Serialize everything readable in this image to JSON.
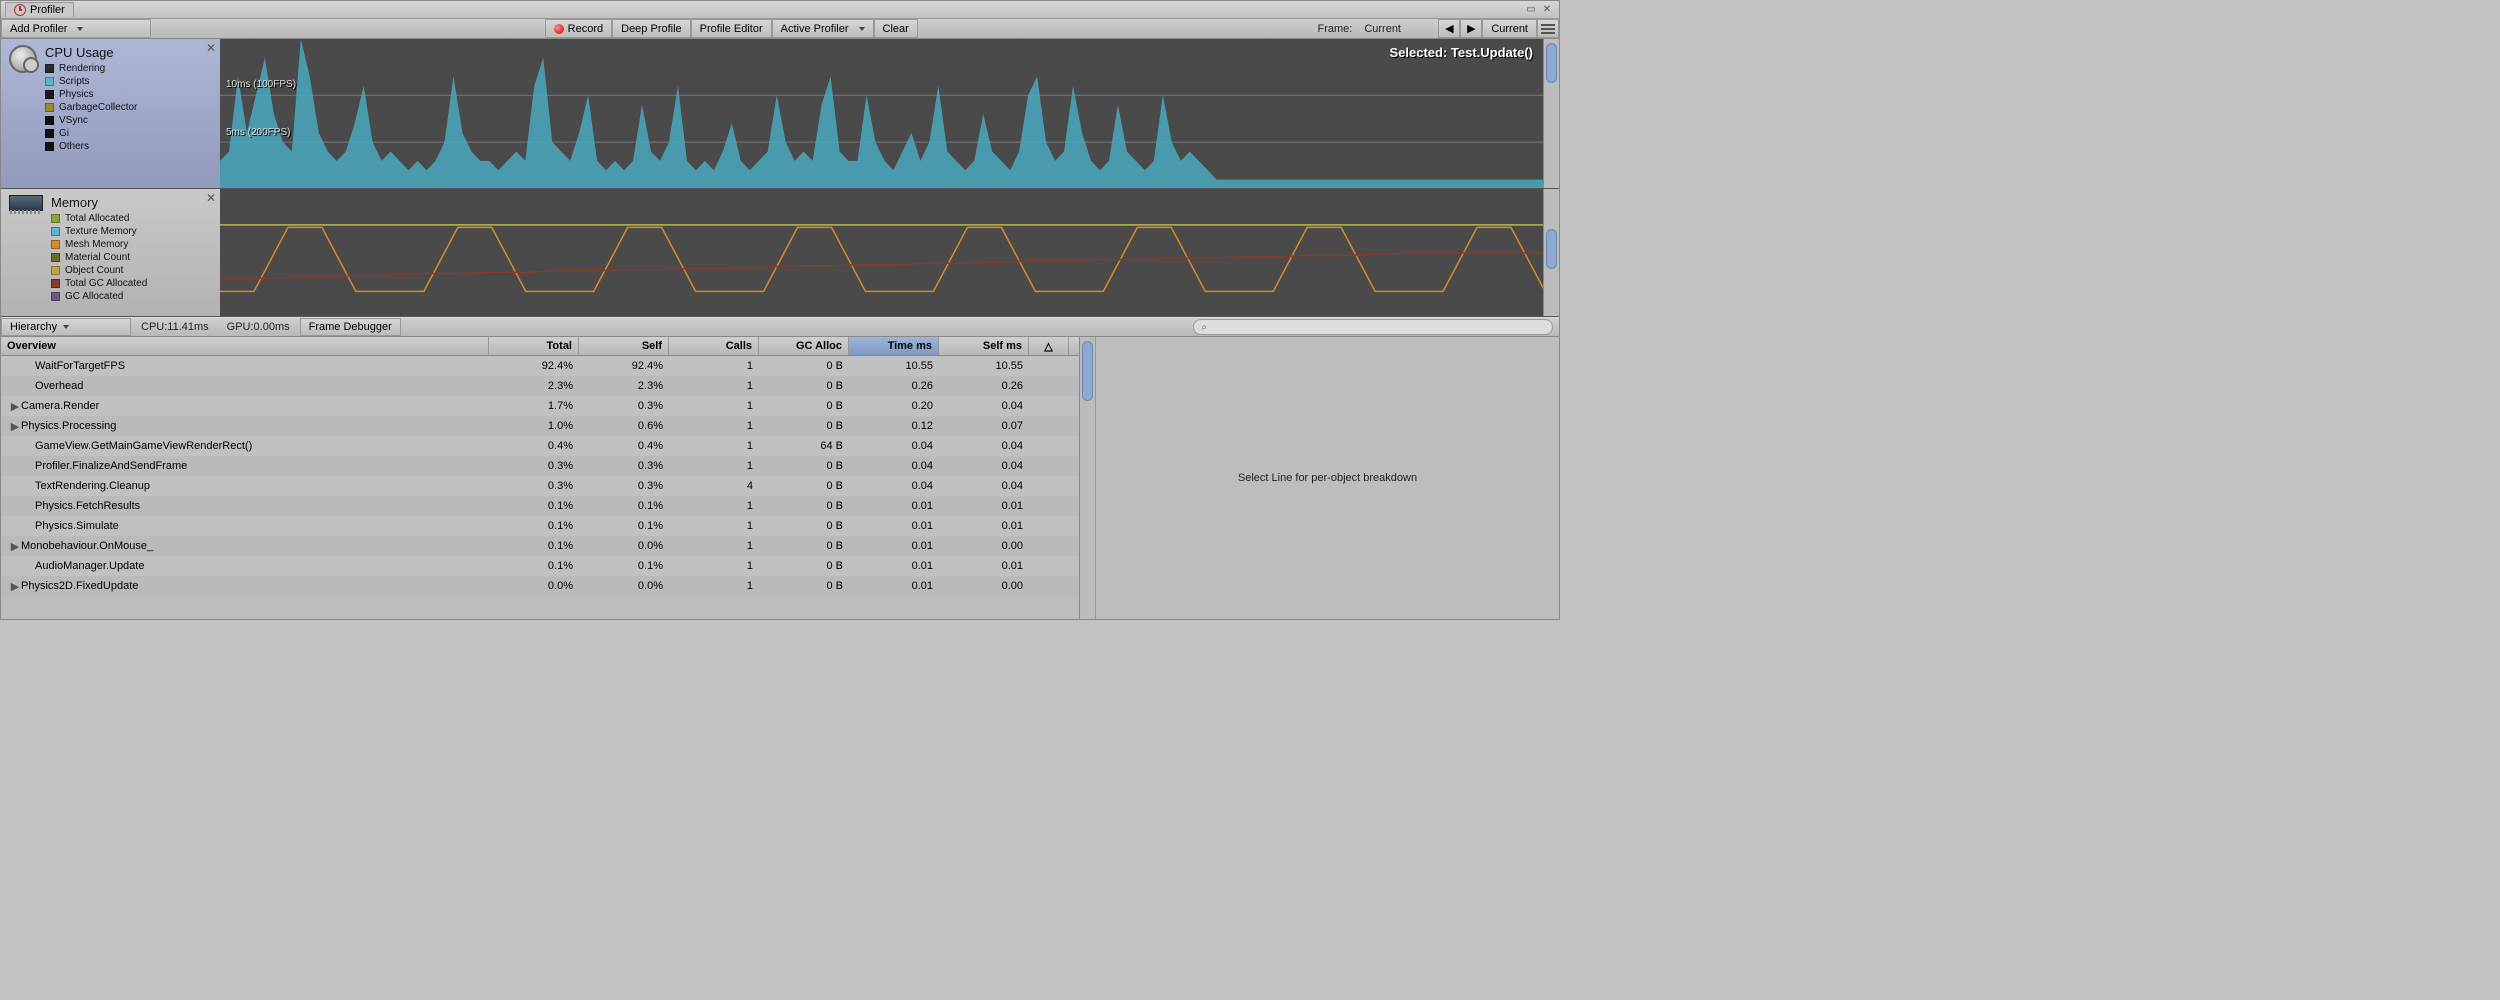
{
  "window": {
    "title": "Profiler"
  },
  "toolbar": {
    "add_profiler": "Add Profiler",
    "record": "Record",
    "deep_profile": "Deep Profile",
    "profile_editor": "Profile Editor",
    "active_profiler": "Active Profiler",
    "clear": "Clear",
    "frame_label": "Frame:",
    "frame_value": "Current",
    "current_btn": "Current"
  },
  "cpu_panel": {
    "title": "CPU Usage",
    "selected": "Selected: Test.Update()",
    "grid_10ms": "10ms (100FPS)",
    "grid_5ms": "5ms (200FPS)",
    "legend": [
      {
        "label": "Rendering",
        "color": "#2a2a2a"
      },
      {
        "label": "Scripts",
        "color": "#5bb4c9"
      },
      {
        "label": "Physics",
        "color": "#1a1a1a"
      },
      {
        "label": "GarbageCollector",
        "color": "#9a8a2a"
      },
      {
        "label": "VSync",
        "color": "#111"
      },
      {
        "label": "Gi",
        "color": "#111"
      },
      {
        "label": "Others",
        "color": "#111"
      }
    ]
  },
  "mem_panel": {
    "title": "Memory",
    "legend": [
      {
        "label": "Total Allocated",
        "color": "#8aa83a"
      },
      {
        "label": "Texture Memory",
        "color": "#5bb4c9"
      },
      {
        "label": "Mesh Memory",
        "color": "#d68a2a"
      },
      {
        "label": "Material Count",
        "color": "#6a6a2a"
      },
      {
        "label": "Object Count",
        "color": "#b8a84a"
      },
      {
        "label": "Total GC Allocated",
        "color": "#8a3a2a"
      },
      {
        "label": "GC Allocated",
        "color": "#6a5a8a"
      }
    ]
  },
  "midbar": {
    "hierarchy": "Hierarchy",
    "cpu_time": "CPU:11.41ms",
    "gpu_time": "GPU:0.00ms",
    "frame_debugger": "Frame Debugger"
  },
  "columns": {
    "overview": "Overview",
    "total": "Total",
    "self": "Self",
    "calls": "Calls",
    "gc": "GC Alloc",
    "time": "Time ms",
    "selfms": "Self ms"
  },
  "rows": [
    {
      "name": "WaitForTargetFPS",
      "expand": false,
      "indent": 1,
      "total": "92.4%",
      "self": "92.4%",
      "calls": "1",
      "gc": "0 B",
      "time": "10.55",
      "selfms": "10.55"
    },
    {
      "name": "Overhead",
      "expand": false,
      "indent": 1,
      "total": "2.3%",
      "self": "2.3%",
      "calls": "1",
      "gc": "0 B",
      "time": "0.26",
      "selfms": "0.26"
    },
    {
      "name": "Camera.Render",
      "expand": true,
      "indent": 0,
      "total": "1.7%",
      "self": "0.3%",
      "calls": "1",
      "gc": "0 B",
      "time": "0.20",
      "selfms": "0.04"
    },
    {
      "name": "Physics.Processing",
      "expand": true,
      "indent": 0,
      "total": "1.0%",
      "self": "0.6%",
      "calls": "1",
      "gc": "0 B",
      "time": "0.12",
      "selfms": "0.07"
    },
    {
      "name": "GameView.GetMainGameViewRenderRect()",
      "expand": false,
      "indent": 1,
      "total": "0.4%",
      "self": "0.4%",
      "calls": "1",
      "gc": "64 B",
      "time": "0.04",
      "selfms": "0.04"
    },
    {
      "name": "Profiler.FinalizeAndSendFrame",
      "expand": false,
      "indent": 1,
      "total": "0.3%",
      "self": "0.3%",
      "calls": "1",
      "gc": "0 B",
      "time": "0.04",
      "selfms": "0.04"
    },
    {
      "name": "TextRendering.Cleanup",
      "expand": false,
      "indent": 1,
      "total": "0.3%",
      "self": "0.3%",
      "calls": "4",
      "gc": "0 B",
      "time": "0.04",
      "selfms": "0.04"
    },
    {
      "name": "Physics.FetchResults",
      "expand": false,
      "indent": 1,
      "total": "0.1%",
      "self": "0.1%",
      "calls": "1",
      "gc": "0 B",
      "time": "0.01",
      "selfms": "0.01"
    },
    {
      "name": "Physics.Simulate",
      "expand": false,
      "indent": 1,
      "total": "0.1%",
      "self": "0.1%",
      "calls": "1",
      "gc": "0 B",
      "time": "0.01",
      "selfms": "0.01"
    },
    {
      "name": "Monobehaviour.OnMouse_",
      "expand": true,
      "indent": 0,
      "total": "0.1%",
      "self": "0.0%",
      "calls": "1",
      "gc": "0 B",
      "time": "0.01",
      "selfms": "0.00"
    },
    {
      "name": "AudioManager.Update",
      "expand": false,
      "indent": 1,
      "total": "0.1%",
      "self": "0.1%",
      "calls": "1",
      "gc": "0 B",
      "time": "0.01",
      "selfms": "0.01"
    },
    {
      "name": "Physics2D.FixedUpdate",
      "expand": true,
      "indent": 0,
      "total": "0.0%",
      "self": "0.0%",
      "calls": "1",
      "gc": "0 B",
      "time": "0.01",
      "selfms": "0.00"
    }
  ],
  "detail_hint": "Select Line for per-object breakdown",
  "chart_data": [
    {
      "type": "area",
      "title": "CPU Usage",
      "ylabel": "ms",
      "ylim": [
        0,
        16
      ],
      "gridlines": [
        5,
        10
      ],
      "series": [
        {
          "name": "Scripts",
          "color": "#4aa8c0",
          "values": [
            3,
            4,
            12,
            6,
            10,
            14,
            8,
            5,
            4,
            16,
            12,
            6,
            4,
            3,
            4,
            7,
            11,
            5,
            3,
            4,
            3,
            2,
            3,
            2,
            3,
            5,
            12,
            6,
            4,
            3,
            3,
            2,
            3,
            4,
            3,
            11,
            14,
            5,
            4,
            3,
            6,
            10,
            3,
            2,
            3,
            2,
            3,
            9,
            4,
            3,
            5,
            11,
            3,
            2,
            3,
            2,
            4,
            7,
            3,
            2,
            3,
            4,
            10,
            5,
            3,
            4,
            3,
            9,
            12,
            4,
            3,
            3,
            10,
            5,
            3,
            2,
            4,
            6,
            3,
            5,
            11,
            4,
            3,
            2,
            3,
            8,
            4,
            3,
            2,
            4,
            10,
            12,
            5,
            3,
            4,
            11,
            6,
            3,
            2,
            3,
            9,
            4,
            3,
            2,
            3,
            10,
            5,
            3,
            4,
            3,
            2,
            1,
            1,
            1,
            1,
            1,
            1,
            1,
            1,
            1,
            1,
            1
          ]
        }
      ]
    },
    {
      "type": "line",
      "title": "Memory",
      "ylim": [
        0,
        100
      ],
      "series": [
        {
          "name": "Total Allocated",
          "color": "#b8b84a",
          "values": [
            72,
            72,
            72,
            72,
            72,
            72,
            72,
            72,
            72,
            72,
            72,
            72,
            72,
            72,
            72,
            72,
            72,
            72,
            72,
            72,
            72,
            72,
            72,
            72,
            72,
            72,
            72,
            72,
            72,
            72,
            72,
            72,
            72,
            72,
            72,
            72,
            72,
            72,
            72,
            72
          ]
        },
        {
          "name": "Mesh Memory",
          "color": "#d68a2a",
          "values": [
            20,
            20,
            70,
            70,
            20,
            20,
            20,
            70,
            70,
            20,
            20,
            20,
            70,
            70,
            20,
            20,
            20,
            70,
            70,
            20,
            20,
            20,
            70,
            70,
            20,
            20,
            20,
            70,
            70,
            20,
            20,
            20,
            70,
            70,
            20,
            20,
            20,
            70,
            70,
            20
          ]
        },
        {
          "name": "Total GC Allocated",
          "color": "#8a3a2a",
          "values": [
            30,
            30,
            31,
            32,
            32,
            33,
            34,
            34,
            35,
            35,
            36,
            36,
            37,
            37,
            38,
            38,
            39,
            40,
            40,
            41,
            41,
            42,
            42,
            43,
            44,
            44,
            45,
            45,
            46,
            46,
            47,
            47,
            48,
            48,
            49,
            50,
            50,
            50,
            50,
            50
          ]
        }
      ]
    }
  ]
}
